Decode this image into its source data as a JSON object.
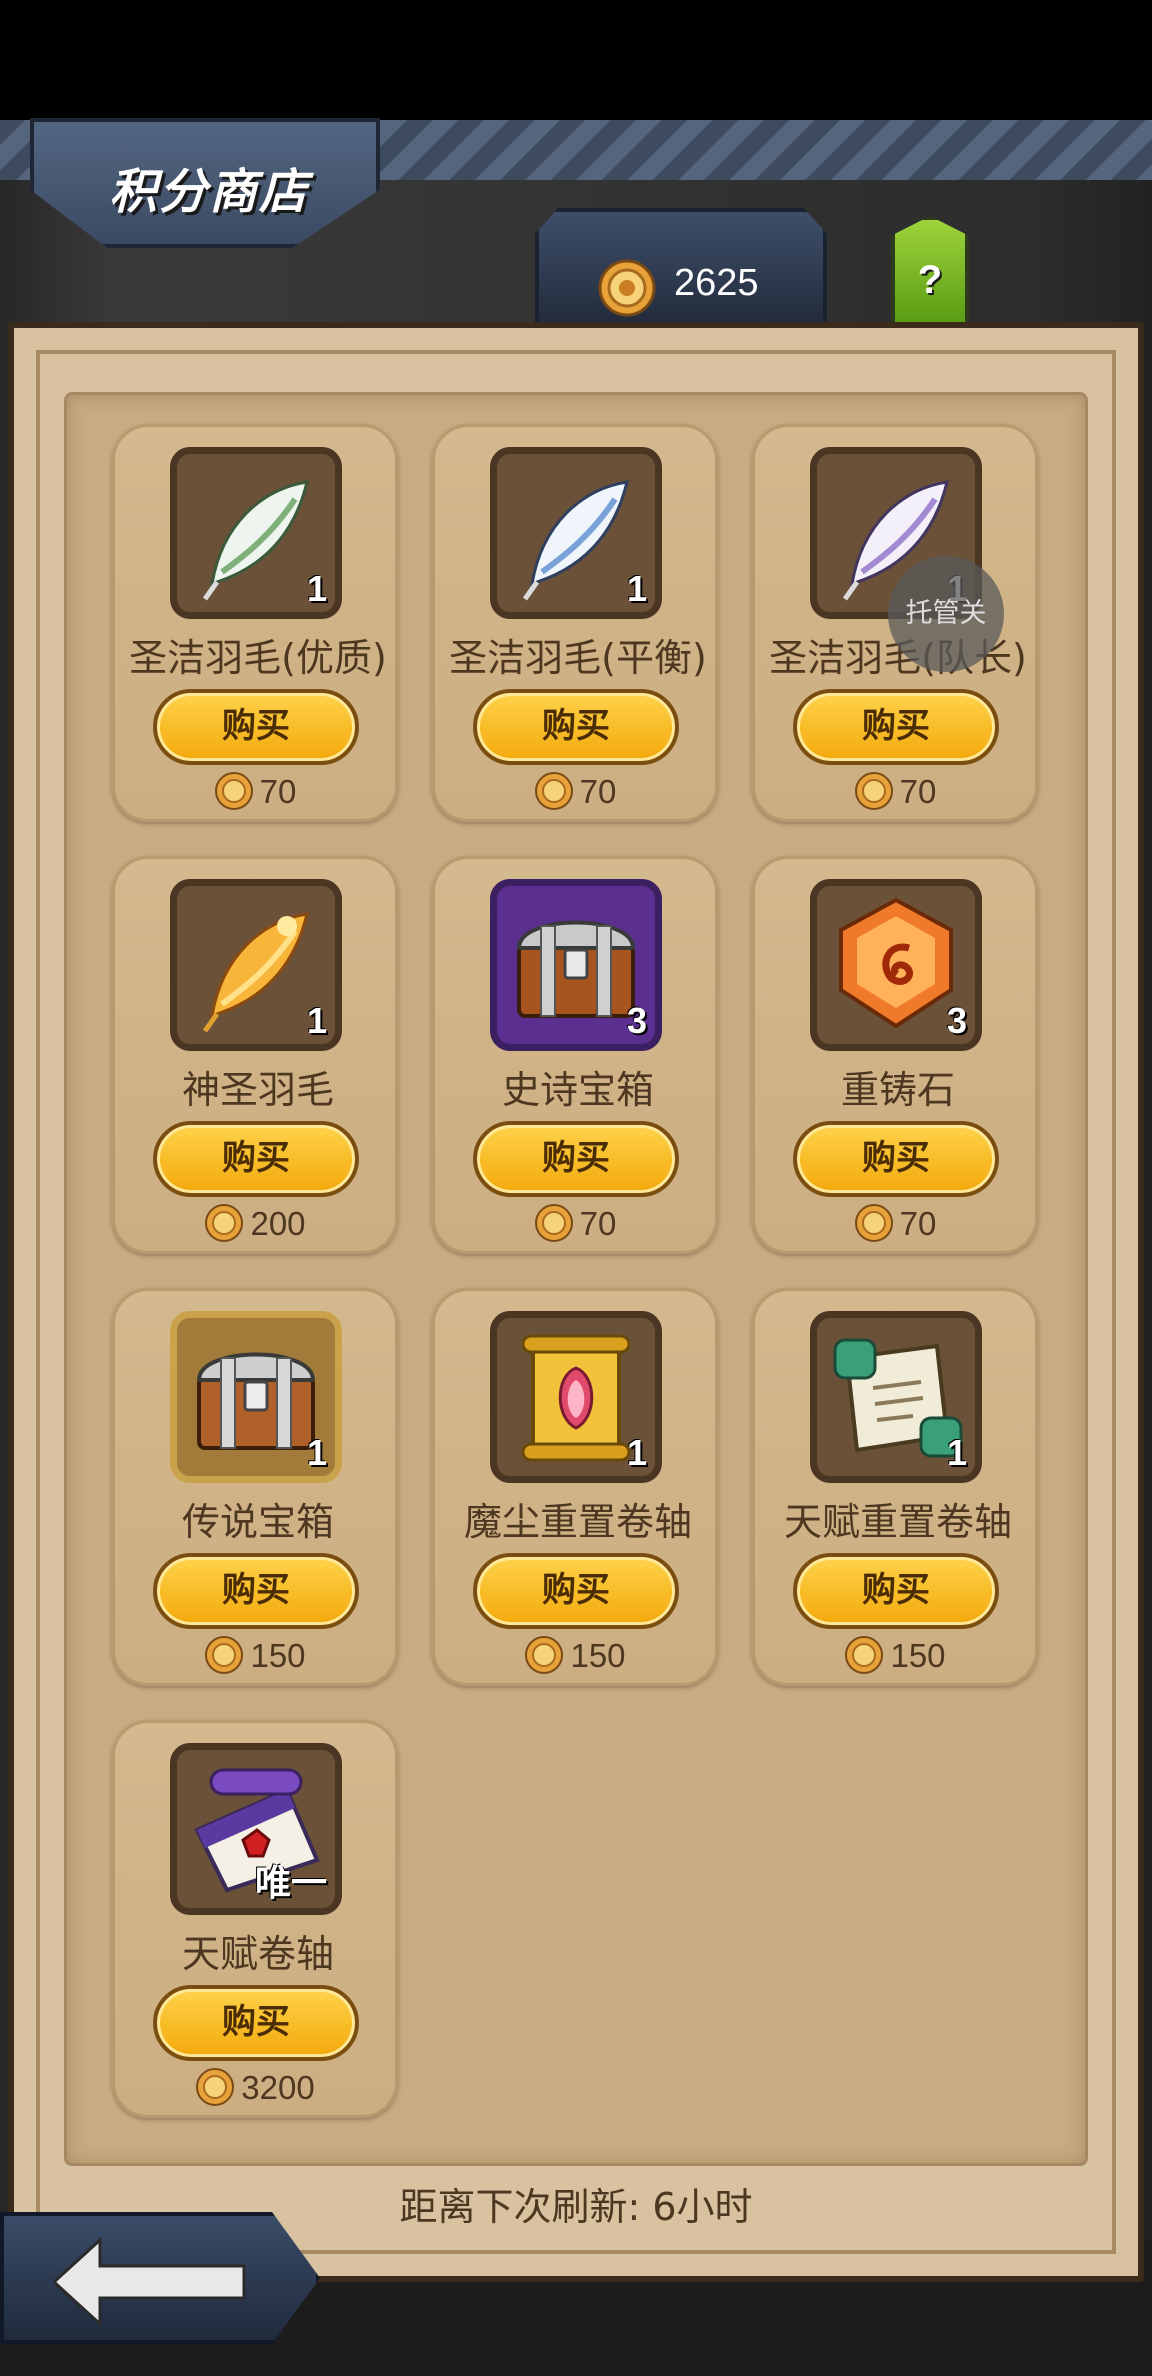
{
  "header": {
    "title": "积分商店",
    "points": "2625",
    "help_label": "?"
  },
  "colors": {
    "panel": "#d8c2a0",
    "button_gold": "#f2a90b",
    "help_green": "#7bb825"
  },
  "items": [
    {
      "name": "圣洁羽毛(优质)",
      "qty": "1",
      "buy_label": "购买",
      "price": "70",
      "icon": "green-feather-icon"
    },
    {
      "name": "圣洁羽毛(平衡)",
      "qty": "1",
      "buy_label": "购买",
      "price": "70",
      "icon": "blue-feather-icon"
    },
    {
      "name": "圣洁羽毛(队长)",
      "qty": "1",
      "buy_label": "购买",
      "price": "70",
      "icon": "purple-feather-icon"
    },
    {
      "name": "神圣羽毛",
      "qty": "1",
      "buy_label": "购买",
      "price": "200",
      "icon": "golden-feather-icon"
    },
    {
      "name": "史诗宝箱",
      "qty": "3",
      "buy_label": "购买",
      "price": "70",
      "icon": "epic-chest-icon"
    },
    {
      "name": "重铸石",
      "qty": "3",
      "buy_label": "购买",
      "price": "70",
      "icon": "reforge-stone-icon"
    },
    {
      "name": "传说宝箱",
      "qty": "1",
      "buy_label": "购买",
      "price": "150",
      "icon": "legendary-chest-icon"
    },
    {
      "name": "魔尘重置卷轴",
      "qty": "1",
      "buy_label": "购买",
      "price": "150",
      "icon": "dust-scroll-icon"
    },
    {
      "name": "天赋重置卷轴",
      "qty": "1",
      "buy_label": "购买",
      "price": "150",
      "icon": "talent-reset-scroll-icon"
    },
    {
      "name": "天赋卷轴",
      "qty": "唯一",
      "buy_label": "购买",
      "price": "3200",
      "icon": "talent-scroll-icon"
    }
  ],
  "footer": {
    "refresh_text": "距离下次刷新: 6小时"
  },
  "overlay": {
    "bubble_text": "托管关"
  }
}
